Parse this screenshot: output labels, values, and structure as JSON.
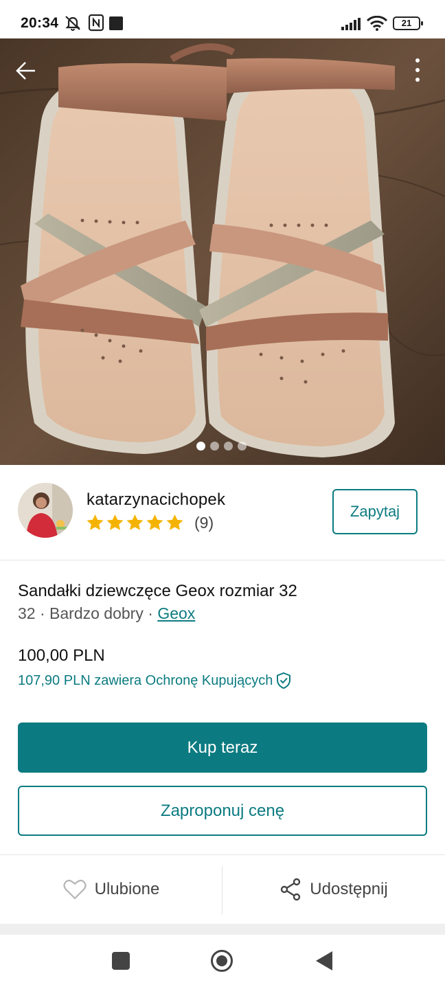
{
  "status_bar": {
    "time": "20:34",
    "battery": "21",
    "icons": [
      "mute-notifications-icon",
      "nfc-icon",
      "app-square-icon",
      "signal-icon",
      "wifi-icon",
      "battery-icon"
    ]
  },
  "photo": {
    "description_icons": [
      "back-arrow-icon",
      "more-vertical-icon"
    ],
    "page_indicator": {
      "count": 4,
      "active_index": 0
    }
  },
  "seller": {
    "username": "katarzynacichopek",
    "rating_stars": 5,
    "review_count": "(9)",
    "ask_button": "Zapytaj"
  },
  "item": {
    "title": "Sandałki dziewczęce Geox rozmiar 32",
    "size": "32",
    "separator": " · ",
    "condition": "Bardzo dobry",
    "brand": "Geox",
    "price": "100,00 PLN",
    "protection_text": "107,90 PLN zawiera Ochronę Kupujących"
  },
  "buttons": {
    "buy_now": "Kup teraz",
    "make_offer": "Zaproponuj cenę"
  },
  "actions": {
    "favourite": "Ulubione",
    "share": "Udostępnij"
  },
  "colors": {
    "accent": "#0b7b81",
    "star": "#f5b301",
    "text": "#111111",
    "muted": "#555555"
  }
}
